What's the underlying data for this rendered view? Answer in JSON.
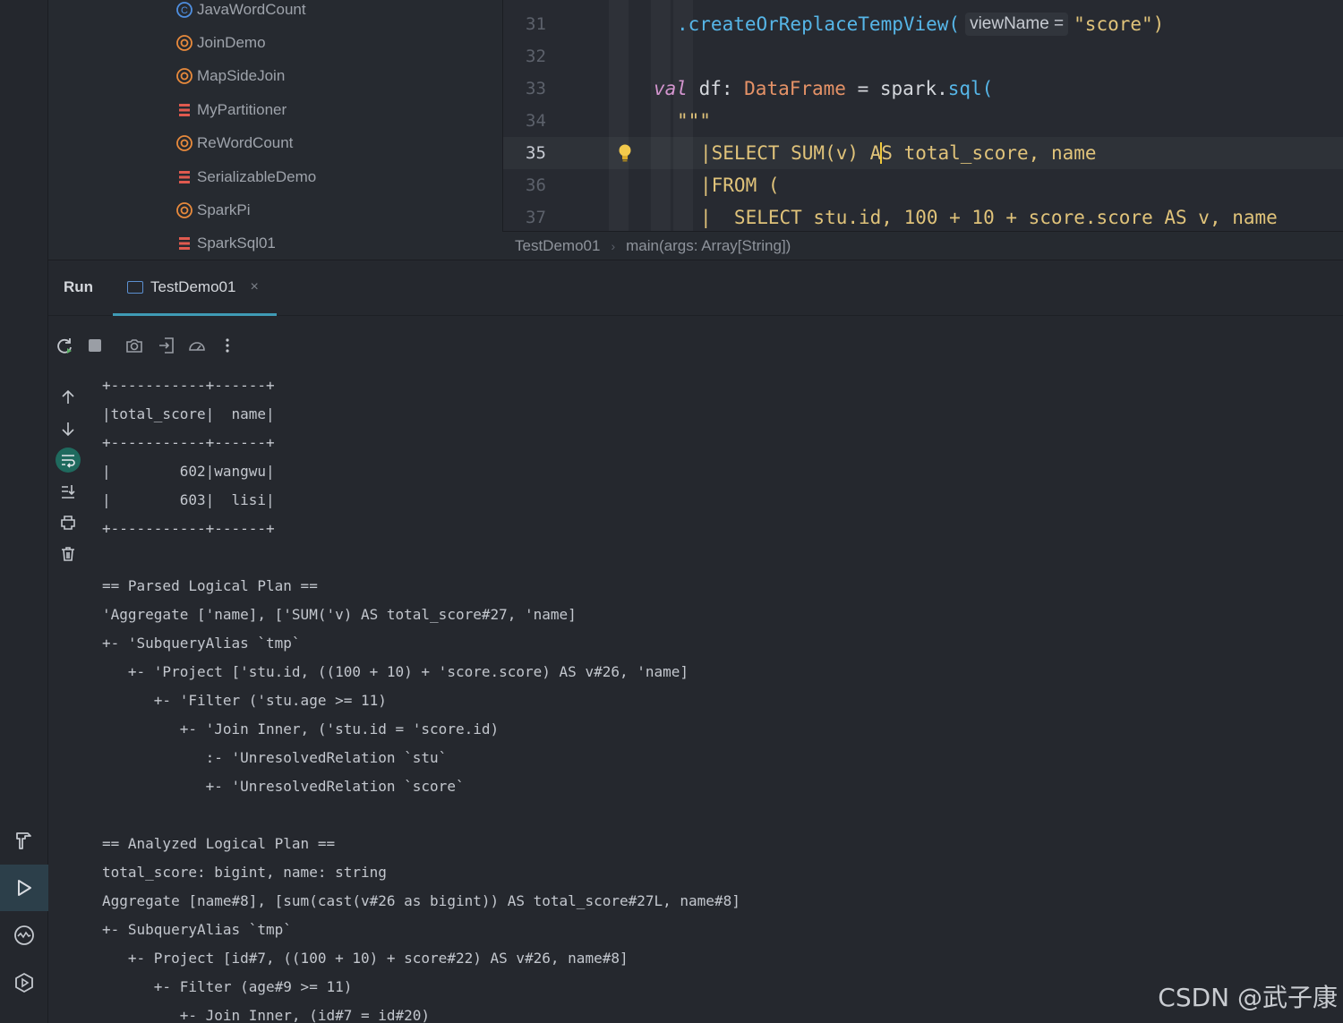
{
  "project_tree": {
    "items": [
      {
        "label": "JavaWordCount",
        "icon": "class-icon",
        "color": "#4f8fe0"
      },
      {
        "label": "JoinDemo",
        "icon": "object-icon",
        "color": "#e88a3c"
      },
      {
        "label": "MapSideJoin",
        "icon": "object-icon",
        "color": "#e88a3c"
      },
      {
        "label": "MyPartitioner",
        "icon": "scala-class-icon",
        "color": "#e05a4f"
      },
      {
        "label": "ReWordCount",
        "icon": "object-icon",
        "color": "#e88a3c"
      },
      {
        "label": "SerializableDemo",
        "icon": "scala-class-icon",
        "color": "#e05a4f"
      },
      {
        "label": "SparkPi",
        "icon": "object-icon",
        "color": "#e88a3c"
      },
      {
        "label": "SparkSql01",
        "icon": "scala-class-icon",
        "color": "#e05a4f"
      }
    ]
  },
  "editor": {
    "line_numbers": [
      "31",
      "32",
      "33",
      "34",
      "35",
      "36",
      "37"
    ],
    "current_line": "35",
    "line31": {
      "method": ".createOrReplaceTempView(",
      "param_hint": "viewName =",
      "string": "\"score\"",
      "close": ")"
    },
    "line33": {
      "kw": "val",
      "name": " df: ",
      "type": "DataFrame",
      "eq": " = spark.",
      "method": "sql(",
      "plain": ""
    },
    "line34": {
      "text": "\"\"\""
    },
    "line35": {
      "before": "|SELECT SUM(v) A",
      "after": "S total_score, name"
    },
    "line36": {
      "text": "|FROM ("
    },
    "line37": {
      "text": "|  SELECT stu.id, 100 + 10 + score.score AS v, name"
    }
  },
  "breadcrumb": {
    "file": "TestDemo01",
    "method": "main(args: Array[String])"
  },
  "run_panel": {
    "label": "Run",
    "tab_label": "TestDemo01",
    "tab_close": "×"
  },
  "console": {
    "lines": [
      "+-----------+------+",
      "|total_score|  name|",
      "+-----------+------+",
      "|        602|wangwu|",
      "|        603|  lisi|",
      "+-----------+------+",
      "",
      "== Parsed Logical Plan ==",
      "'Aggregate ['name], ['SUM('v) AS total_score#27, 'name]",
      "+- 'SubqueryAlias `tmp`",
      "   +- 'Project ['stu.id, ((100 + 10) + 'score.score) AS v#26, 'name]",
      "      +- 'Filter ('stu.age >= 11)",
      "         +- 'Join Inner, ('stu.id = 'score.id)",
      "            :- 'UnresolvedRelation `stu`",
      "            +- 'UnresolvedRelation `score`",
      "",
      "== Analyzed Logical Plan ==",
      "total_score: bigint, name: string",
      "Aggregate [name#8], [sum(cast(v#26 as bigint)) AS total_score#27L, name#8]",
      "+- SubqueryAlias `tmp`",
      "   +- Project [id#7, ((100 + 10) + score#22) AS v#26, name#8]",
      "      +- Filter (age#9 >= 11)",
      "         +- Join Inner, (id#7 = id#20)"
    ]
  },
  "watermark": "CSDN @武子康"
}
